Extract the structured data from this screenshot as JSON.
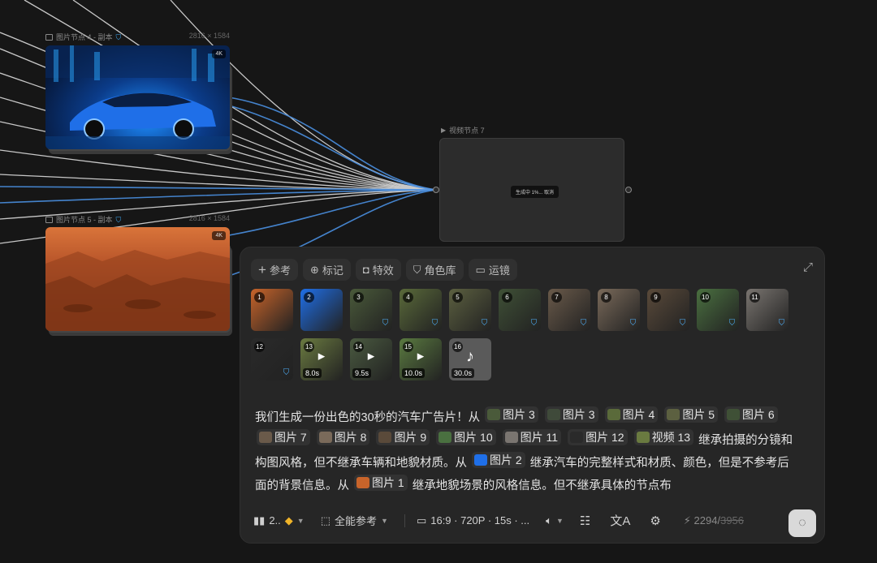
{
  "nodes": {
    "image4": {
      "title": "图片节点 4 - 副本",
      "dims": "2816 × 1584",
      "zoom": "4K"
    },
    "image5": {
      "title": "图片节点 5 - 副本",
      "dims": "2816 × 1584",
      "zoom": "4K"
    },
    "video7": {
      "title": "视频节点 7",
      "status": "生成中 1%... 取消"
    }
  },
  "toolbar": {
    "reference": "参考",
    "mark": "标记",
    "effects": "特效",
    "character_library": "角色库",
    "camera_move": "运镜"
  },
  "thumbnails": [
    {
      "n": "1",
      "shield": false
    },
    {
      "n": "2",
      "shield": false
    },
    {
      "n": "3",
      "shield": true
    },
    {
      "n": "4",
      "shield": true
    },
    {
      "n": "5",
      "shield": true
    },
    {
      "n": "6",
      "shield": true
    },
    {
      "n": "7",
      "shield": true
    },
    {
      "n": "8",
      "shield": true
    },
    {
      "n": "9",
      "shield": true
    },
    {
      "n": "10",
      "shield": true
    },
    {
      "n": "11",
      "shield": true
    },
    {
      "n": "12",
      "shield": true
    },
    {
      "n": "13",
      "duration": "8.0s"
    },
    {
      "n": "14",
      "duration": "9.5s"
    },
    {
      "n": "15",
      "duration": "10.0s"
    },
    {
      "n": "16",
      "duration": "30.0s",
      "audio": true
    }
  ],
  "prompt": {
    "t1": "我们生成一份出色的30秒的汽车广告片！从",
    "c1": "图片 3",
    "c2": "图片 3",
    "c3": "图片 4",
    "c4": "图片 5",
    "c5": "图片 6",
    "c6": "图片 7",
    "c7": "图片 8",
    "c8": "图片 9",
    "c9": "图片 10",
    "c10": "图片 11",
    "c11": "图片 12",
    "c12": "视频 13",
    "t2": "继承拍摄的分镜和构图风格，但不继承车辆和地貌材质。从",
    "c13": "图片 2",
    "t3": "继承汽车的完整样式和材质、颜色，但是不参考后面的背景信息。从",
    "c14": "图片 1",
    "t4": "继承地貌场景的风格信息。但不继承具体的节点布"
  },
  "bottom": {
    "model": "2..",
    "ref_mode": "全能参考",
    "spec": "16:9 · 720P · 15s · ...",
    "credits_now": "2294",
    "credits_old": "3956"
  }
}
